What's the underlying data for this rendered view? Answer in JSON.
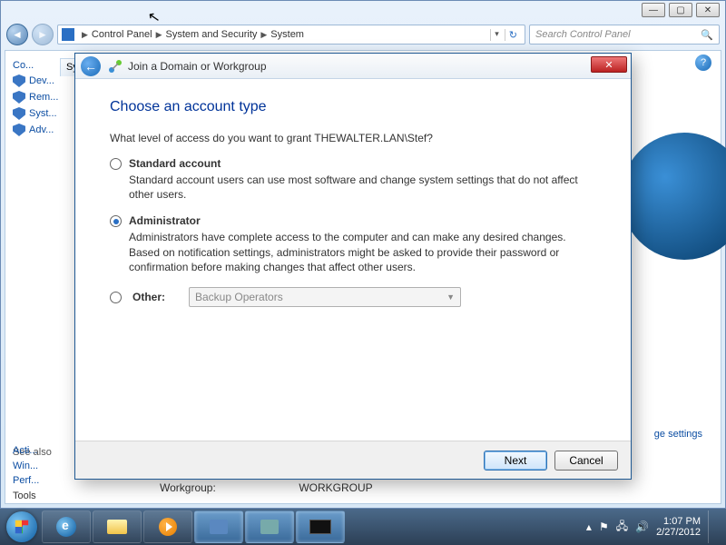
{
  "explorer": {
    "breadcrumb": [
      "Control Panel",
      "System and Security",
      "System"
    ],
    "search_placeholder": "Search Control Panel",
    "sidebar": {
      "items": [
        {
          "label": "Co..."
        },
        {
          "label": "Dev..."
        },
        {
          "label": "Rem..."
        },
        {
          "label": "Syst..."
        },
        {
          "label": "Adv..."
        }
      ],
      "see_also_heading": "See also",
      "see_also": [
        {
          "label": "Acti..."
        },
        {
          "label": "Win..."
        },
        {
          "label": "Perf..."
        },
        {
          "label": "Tools"
        }
      ]
    },
    "lower_label": "Workgroup:",
    "lower_value": "WORKGROUP",
    "change_link": "ge settings",
    "truncated_header": "Sy"
  },
  "dialog": {
    "title": "Join a Domain or Workgroup",
    "heading": "Choose an account type",
    "question": "What level of access do you want to grant THEWALTER.LAN\\Stef?",
    "options": {
      "standard": {
        "label": "Standard account",
        "desc": "Standard account users can use most software and change system settings that do not affect other users.",
        "checked": false
      },
      "admin": {
        "label": "Administrator",
        "desc": "Administrators have complete access to the computer and can make any desired changes. Based on notification settings, administrators might be asked to provide their password or confirmation before making changes that affect other users.",
        "checked": true
      },
      "other": {
        "label": "Other:",
        "value": "Backup Operators",
        "checked": false
      }
    },
    "buttons": {
      "next": "Next",
      "cancel": "Cancel"
    }
  },
  "taskbar": {
    "time": "1:07 PM",
    "date": "2/27/2012"
  }
}
